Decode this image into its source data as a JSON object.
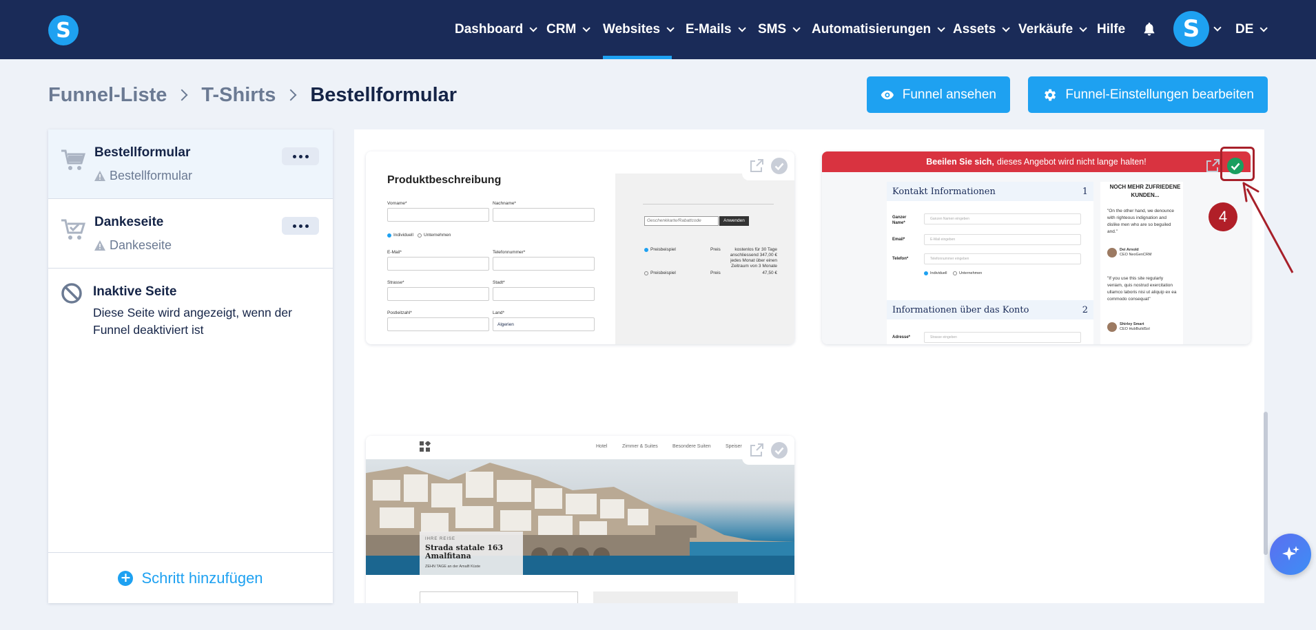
{
  "nav": {
    "logo": "S",
    "items": [
      {
        "label": "Dashboard",
        "chevron": true
      },
      {
        "label": "CRM",
        "chevron": true
      },
      {
        "label": "Websites",
        "chevron": true,
        "active": true
      },
      {
        "label": "E-Mails",
        "chevron": true
      },
      {
        "label": "SMS",
        "chevron": true
      },
      {
        "label": "Automatisierungen",
        "chevron": true
      },
      {
        "label": "Assets",
        "chevron": true
      },
      {
        "label": "Verkäufe",
        "chevron": true
      },
      {
        "label": "Hilfe",
        "chevron": false
      }
    ],
    "bell_icon": "bell-icon",
    "avatar": "S",
    "language": "DE"
  },
  "breadcrumb": [
    "Funnel-Liste",
    "T-Shirts",
    "Bestellformular"
  ],
  "buttons": {
    "view_funnel": "Funnel ansehen",
    "edit_settings": "Funnel-Einstellungen bearbeiten"
  },
  "sidebar": {
    "steps": [
      {
        "title": "Bestellformular",
        "subtitle": "Bestellformular",
        "icon": "cart-icon"
      },
      {
        "title": "Dankeseite",
        "subtitle": "Dankeseite",
        "icon": "cart-check-icon"
      }
    ],
    "inactive": {
      "title": "Inaktive Seite",
      "description": "Diese Seite wird angezeigt, wenn der Funnel deaktiviert ist"
    },
    "add_step": "Schritt hinzufügen"
  },
  "templates": {
    "card1": {
      "heading": "Produktbeschreibung",
      "labels": [
        "Vorname*",
        "Nachname*",
        "E-Mail*",
        "Telefonnummer*",
        "Strasse*",
        "Stadt*",
        "Postleitzahl*",
        "Land*"
      ],
      "radio_individual": "Individuell",
      "radio_company": "Unternehmen",
      "country_value": "Algerien",
      "coupon_placeholder": "Geschenkkarte/Rabattcode",
      "apply": "Anwenden",
      "price_example_1": "Preisbeispiel",
      "price_label_1": "Preis",
      "price_desc_1": "kostenlos für 30 Tage anschliessend 347,00 € jedes Monat über einen Zeitraum von 3 Monate",
      "price_example_2": "Preisbeispiel",
      "price_label_2": "Preis",
      "price_value_2": "47,50 €"
    },
    "card2": {
      "banner_bold": "Beeilen Sie sich,",
      "banner_text": "dieses Angebot wird nicht lange halten!",
      "section1": "Kontakt Informationen",
      "section1_num": "1",
      "field_name": "Ganzer Name*",
      "field_name_ph": "Ganzen Namen eingeben",
      "field_email": "Email*",
      "field_email_ph": "E-Mail eingeben",
      "field_phone": "Telefon*",
      "field_phone_ph": "Telefonnummer eingeben",
      "radio_individual": "Individuell",
      "radio_company": "Unternehmen",
      "section2": "Informationen über das Konto",
      "section2_num": "2",
      "field_address": "Adresse*",
      "field_address_ph": "Strasse eingeben",
      "testimonial_title": "NOCH MEHR ZUFRIEDENE KUNDEN...",
      "quote1": "\"On the other hand, we denounce with righteous indignation and dislike men who are so beguiled and.\"",
      "author1": "Dei Arnold",
      "author1_role": "CEO NeoGenCRM",
      "quote2": "\"If you use this site regularly veniam, quis nostrud exercitation ullamco laboris nisi ut aliquip ex ea commodo consequat\"",
      "author2": "Shirley Smart",
      "author2_role": "CEO HubBuildSol"
    },
    "card3": {
      "menu": [
        "Hotel",
        "Zimmer & Suites",
        "Besondere Suiten",
        "Speisen"
      ],
      "kicker": "IHRE REISE",
      "title": "Strada statale 163 Amalfitana",
      "sub": "ZEHN TAGE an der Amalfi Küste"
    }
  },
  "annotation": {
    "badge": "4"
  },
  "colors": {
    "nav_bg": "#1a2b58",
    "accent": "#1ea1f1",
    "annotation": "#a7202a",
    "banner": "#d93340",
    "selected_check": "#1a9e5f"
  }
}
